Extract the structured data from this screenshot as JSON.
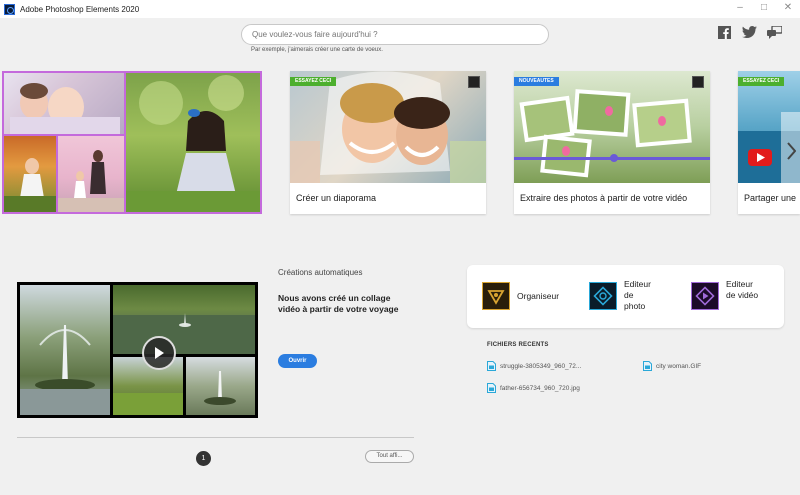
{
  "window": {
    "title": "Adobe Photoshop Elements 2020",
    "controls": [
      "–",
      "□",
      "✕"
    ]
  },
  "search": {
    "placeholder": "Que voulez-vous faire aujourd'hui ?",
    "hint": "Par exemple, j'aimerais créer une carte de voeux."
  },
  "social": [
    "facebook-icon",
    "twitter-icon",
    "feedback-icon"
  ],
  "carousel": {
    "cards": [
      {
        "tag": "ESSAYEZ CECI",
        "tag_color": "#4caf2e",
        "title": "Créer un diaporama"
      },
      {
        "tag": "NOUVEAUTES",
        "tag_color": "#2b7de0",
        "title": "Extraire des photos à partir de votre vidéo"
      },
      {
        "tag": "ESSAYEZ CECI",
        "tag_color": "#4caf2e",
        "title": "Partager une"
      }
    ],
    "next_icon": "chevron-right-icon"
  },
  "auto_creations": {
    "label": "Créations automatiques",
    "description": "Nous avons créé un collage vidéo à partir de votre voyage",
    "open_button": "Ouvrir",
    "page": "1",
    "show_all": "Tout affi..."
  },
  "editors": [
    {
      "label": "Organiseur",
      "icon": "organizer-icon",
      "color": "#d9a431"
    },
    {
      "label": "Editeur de photo",
      "icon": "photo-editor-icon",
      "color": "#2aa8d8"
    },
    {
      "label": "Editeur de vidéo",
      "icon": "video-editor-icon",
      "color": "#a06ad8"
    }
  ],
  "recent": {
    "title": "FICHIERS RECENTS",
    "files": [
      "struggle-3805349_960_72...",
      "city woman.GIF",
      "father-656734_960_720.jpg"
    ]
  }
}
